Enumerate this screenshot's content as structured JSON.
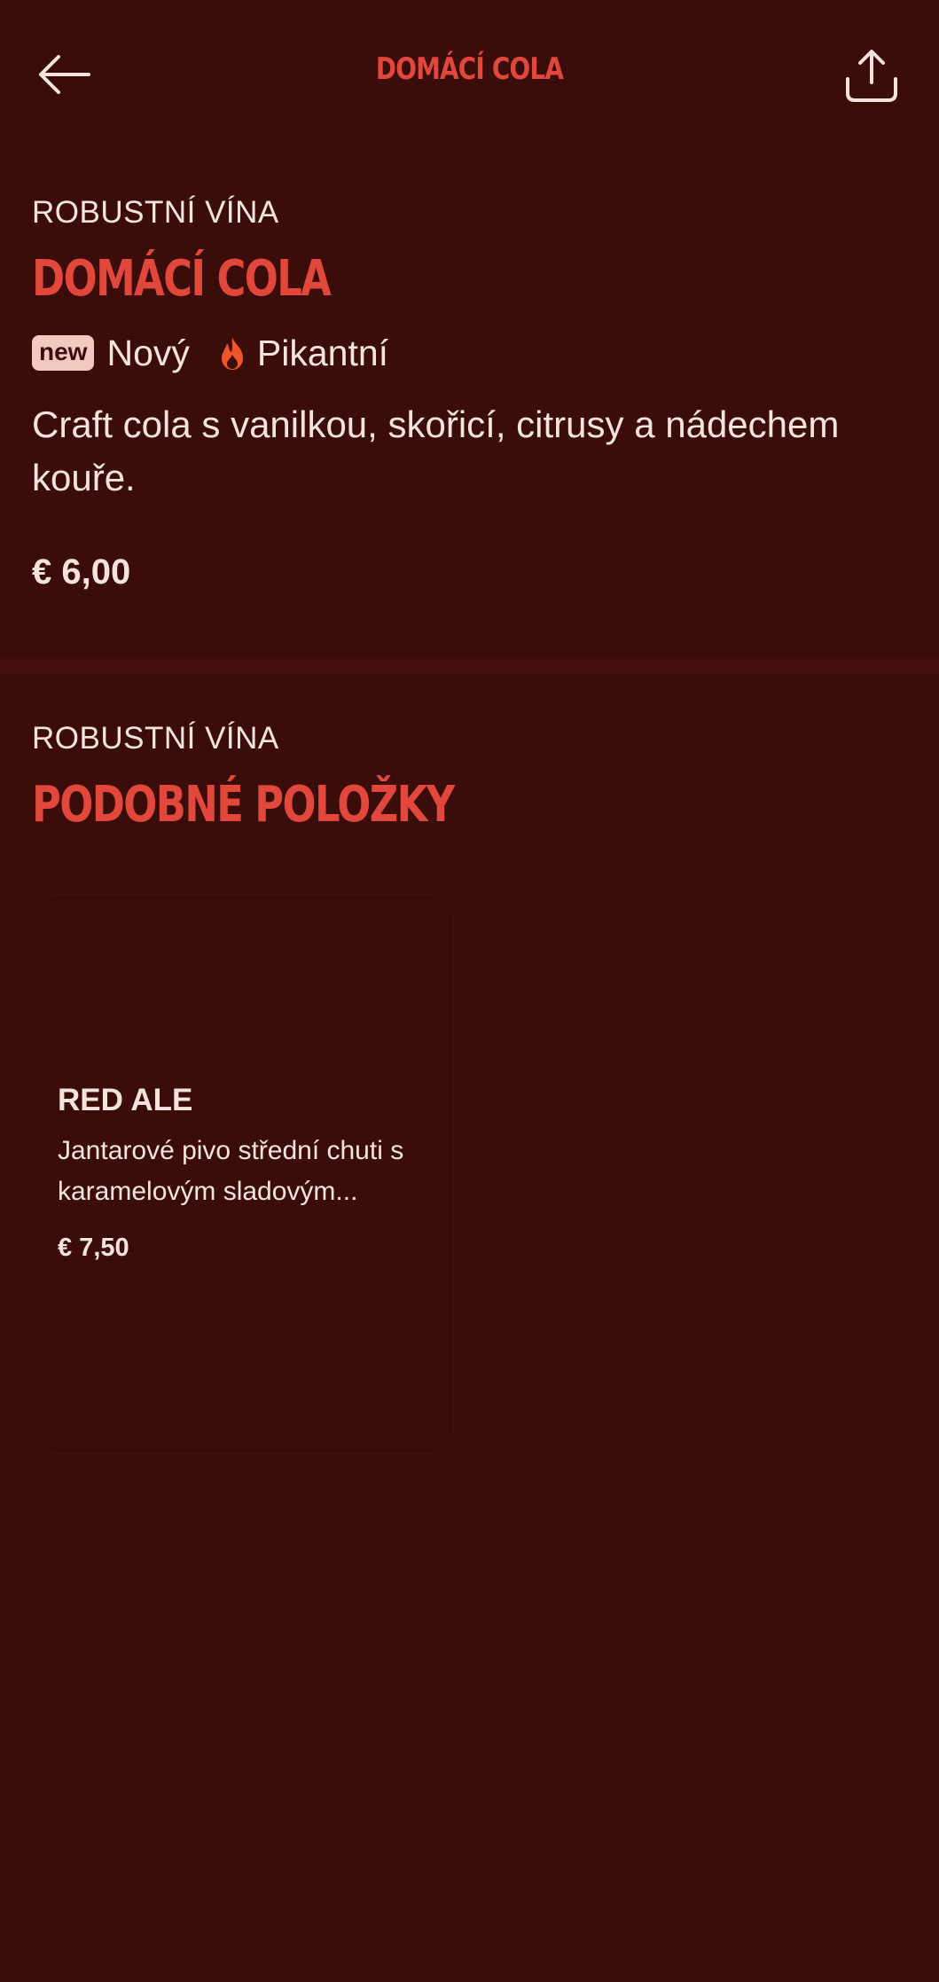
{
  "colors": {
    "background": "#3a0d0b",
    "accent": "#e2473b",
    "text": "#f6e3dd",
    "badge": "#f1c9c1",
    "fire": "#f0542c"
  },
  "header": {
    "title": "DOMÁCÍ COLA",
    "back_icon": "arrow-left-icon",
    "share_icon": "share-icon"
  },
  "item": {
    "category": "ROBUSTNÍ VÍNA",
    "name": "DOMÁCÍ COLA",
    "badge": "new",
    "tag_new": "Nový",
    "tag_spicy": "Pikantní",
    "spicy_icon": "fire-icon",
    "description": "Craft cola s vanilkou, skořicí, citrusy a nádechem kouře.",
    "price": "€ 6,00"
  },
  "similar": {
    "category": "ROBUSTNÍ VÍNA",
    "title": "PODOBNÉ POLOŽKY",
    "cards": [
      {
        "name": "RED ALE",
        "description": "Jantarové pivo střední chuti s karamelovým sladovým...",
        "price": "€ 7,50"
      }
    ]
  }
}
